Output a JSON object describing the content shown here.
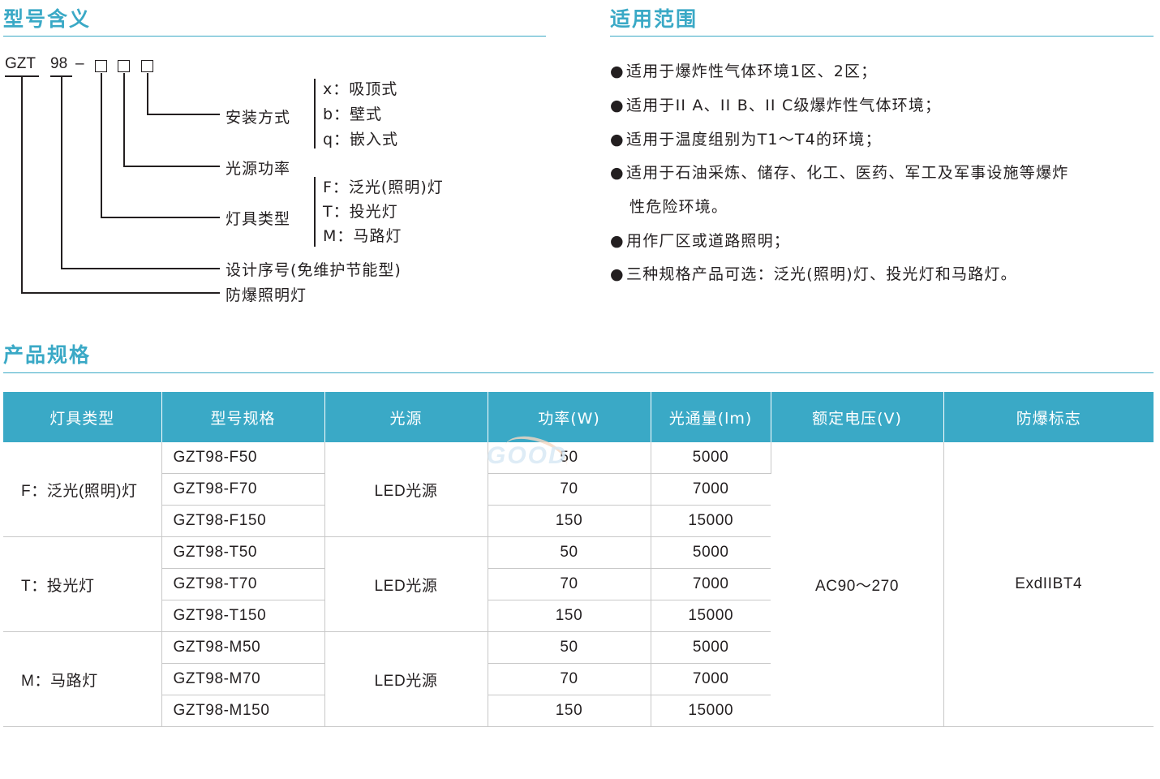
{
  "sections": {
    "model_meaning": "型号含义",
    "scope": "适用范围",
    "spec": "产品规格"
  },
  "model_diagram": {
    "prefix": "GZT",
    "series": "98",
    "dash": "–",
    "install_label": "安装方式",
    "install_options": [
      "x：吸顶式",
      "b：壁式",
      "q：嵌入式"
    ],
    "power_label": "光源功率",
    "type_label": "灯具类型",
    "type_options": [
      "F：泛光(照明)灯",
      "T：投光灯",
      "M：马路灯"
    ],
    "design_label": "设计序号(免维护节能型)",
    "product_label": "防爆照明灯"
  },
  "scope_items": [
    "适用于爆炸性气体环境1区、2区；",
    "适用于II A、II B、II C级爆炸性气体环境；",
    "适用于温度组别为T1～T4的环境；",
    "适用于石油采炼、储存、化工、医药、军工及军事设施等爆炸",
    "性危险环境。",
    "用作厂区或道路照明；",
    "三种规格产品可选：泛光(照明)灯、投光灯和马路灯。"
  ],
  "bullet": "●",
  "table": {
    "headers": [
      "灯具类型",
      "型号规格",
      "光源",
      "功率(W)",
      "光通量(lm)",
      "额定电压(V)",
      "防爆标志"
    ],
    "groups": [
      {
        "type": "F：泛光(照明)灯",
        "source": "LED光源",
        "rows": [
          [
            "GZT98-F50",
            "50",
            "5000"
          ],
          [
            "GZT98-F70",
            "70",
            "7000"
          ],
          [
            "GZT98-F150",
            "150",
            "15000"
          ]
        ]
      },
      {
        "type": "T：投光灯",
        "source": "LED光源",
        "rows": [
          [
            "GZT98-T50",
            "50",
            "5000"
          ],
          [
            "GZT98-T70",
            "70",
            "7000"
          ],
          [
            "GZT98-T150",
            "150",
            "15000"
          ]
        ]
      },
      {
        "type": "M：马路灯",
        "source": "LED光源",
        "rows": [
          [
            "GZT98-M50",
            "50",
            "5000"
          ],
          [
            "GZT98-M70",
            "70",
            "7000"
          ],
          [
            "GZT98-M150",
            "150",
            "15000"
          ]
        ]
      }
    ],
    "voltage": "AC90～270",
    "ex_mark": "ExdIIBT4"
  },
  "watermark": "GOOD",
  "colors": {
    "accent": "#3aa9c6",
    "text": "#231f20"
  }
}
